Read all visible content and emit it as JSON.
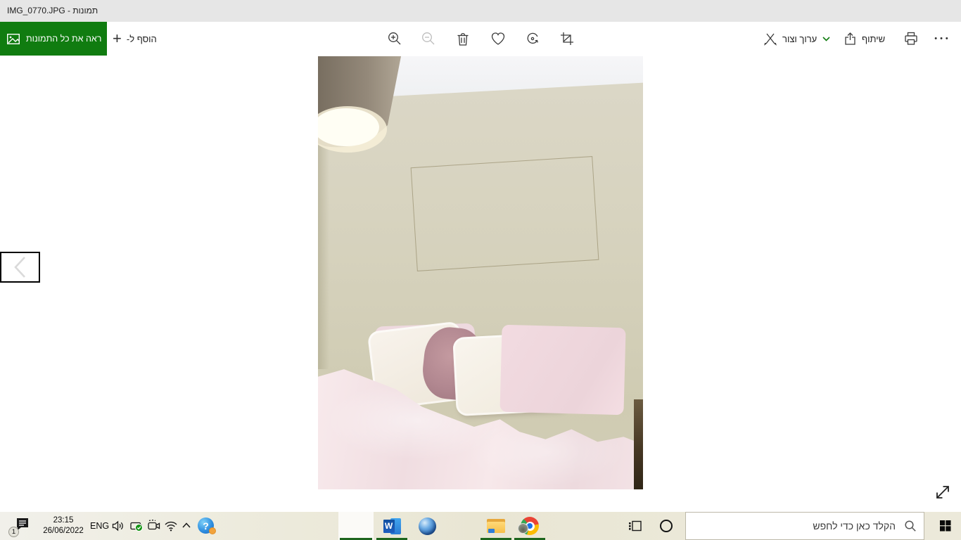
{
  "titlebar": {
    "title": "IMG_0770.JPG - תמונות"
  },
  "toolbar": {
    "see_all_photos_label": "ראה את כל התמונות",
    "add_to_label": "הוסף ל-",
    "edit_create_label": "ערוך וצור",
    "share_label": "שיתוף"
  },
  "icons": {
    "plus": "+",
    "ellipsis": "•••",
    "question_mark": "?",
    "word_letter": "W"
  },
  "taskbar": {
    "notification_count": "1",
    "time": "23:15",
    "date": "26/06/2022",
    "language": "ENG",
    "search_placeholder": "הקלד כאן כדי לחפש"
  },
  "colors": {
    "accent_green": "#107c10",
    "running_indicator_green": "#1d651d",
    "titlebar_gray": "#e6e6e6",
    "taskbar_tint": "#ebe8d9",
    "wall_beige": "#d6d2bd",
    "duvet_pink": "#f4e3e6",
    "pillow_mauve": "#b98f96",
    "help_icon_blue": "#2f8fe0",
    "help_badge_orange": "#f2a33c"
  }
}
